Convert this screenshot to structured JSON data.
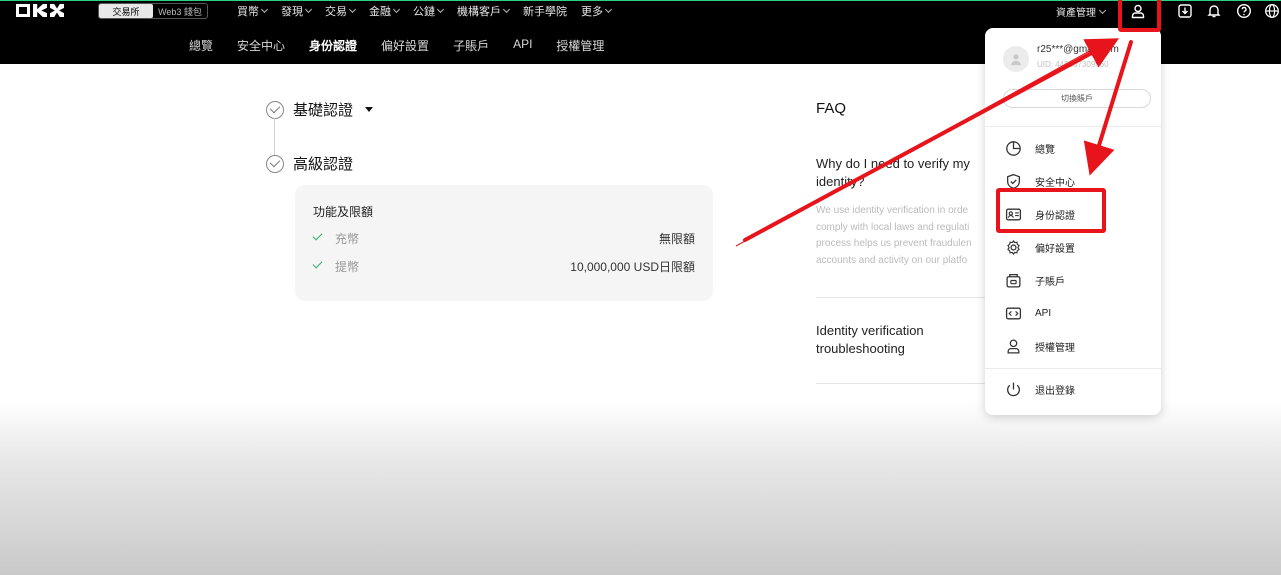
{
  "topnav": {
    "switch": [
      "交易所",
      "Web3 錢包"
    ],
    "menu": [
      "買幣",
      "發現",
      "交易",
      "金融",
      "公鏈",
      "機構客戶",
      "新手學院",
      "更多"
    ],
    "asset_label": "資產管理"
  },
  "subnav": {
    "items": [
      "總覽",
      "安全中心",
      "身份認證",
      "偏好設置",
      "子賬戶",
      "API",
      "授權管理"
    ],
    "active_index": 2
  },
  "verification": {
    "basic_label": "基礎認證",
    "advanced_label": "高級認證",
    "features_title": "功能及限額",
    "features": [
      {
        "label": "充幣",
        "value": "無限額"
      },
      {
        "label": "提幣",
        "value": "10,000,000 USD日限額"
      }
    ]
  },
  "faq": {
    "title": "FAQ",
    "q1": "Why do I need to verify my identity?",
    "a1": "We use identity verification in orde\ncomply with local laws and regulati\nprocess helps us prevent fraudulen\naccounts and activity on our platfo",
    "q2": "Identity verification troubleshooting"
  },
  "dropdown": {
    "email": "r25***@gmail.com",
    "uid": "UID: 445867309560",
    "switch_label": "切換賬戶",
    "items": [
      {
        "label": "總覽",
        "icon": "pie-chart-icon"
      },
      {
        "label": "安全中心",
        "icon": "shield-icon"
      },
      {
        "label": "身份認證",
        "icon": "id-card-icon"
      },
      {
        "label": "偏好設置",
        "icon": "gear-icon"
      },
      {
        "label": "子賬戶",
        "icon": "sub-account-icon"
      },
      {
        "label": "API",
        "icon": "api-icon"
      },
      {
        "label": "授權管理",
        "icon": "authorization-icon"
      }
    ],
    "logout_label": "退出登錄"
  },
  "annotation": {
    "highlight_color": "#e8141b"
  }
}
